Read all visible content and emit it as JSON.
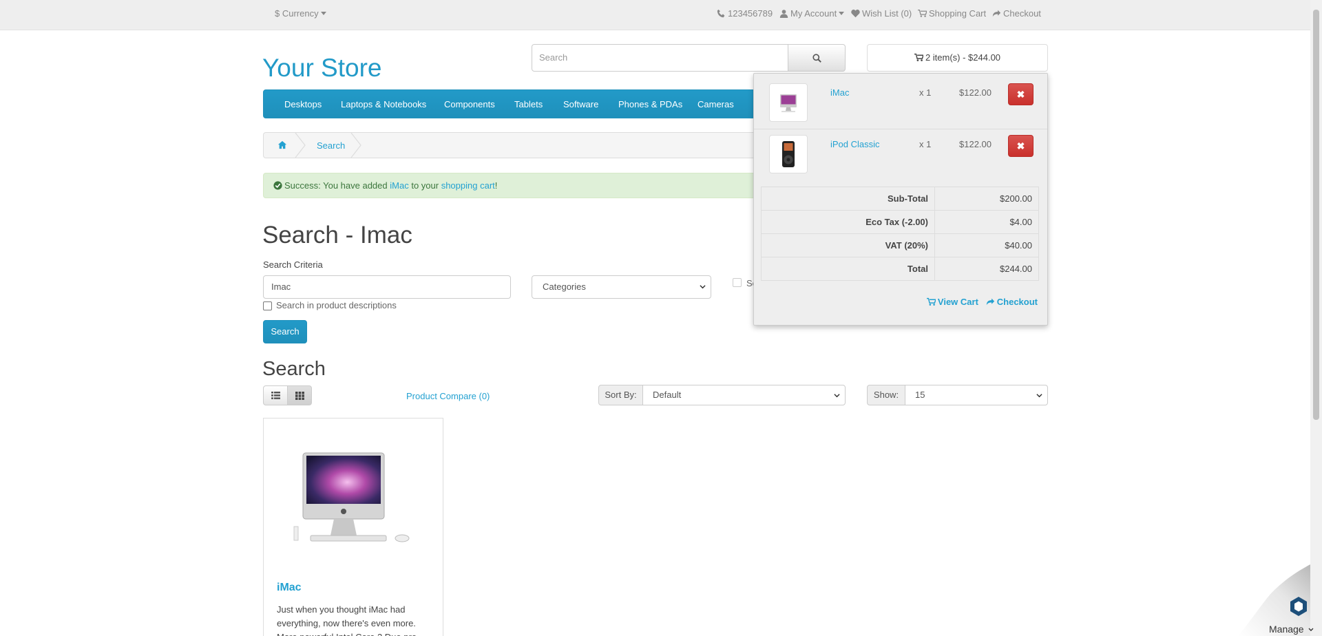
{
  "topbar": {
    "currency": "$ Currency",
    "phone": "123456789",
    "my_account": "My Account",
    "wishlist": "Wish List (0)",
    "shopping_cart": "Shopping Cart",
    "checkout": "Checkout"
  },
  "header": {
    "logo": "Your Store",
    "search_placeholder": "Search",
    "cart_button": "2 item(s) - $244.00"
  },
  "menu": [
    "Desktops",
    "Laptops & Notebooks",
    "Components",
    "Tablets",
    "Software",
    "Phones & PDAs",
    "Cameras"
  ],
  "breadcrumb": {
    "current": "Search"
  },
  "alert": {
    "prefix": "Success: You have added",
    "product": "iMac",
    "middle": "to your",
    "link": "shopping cart",
    "suffix": "!"
  },
  "page": {
    "title": "Search - Imac",
    "criteria_label": "Search Criteria",
    "criteria_value": "Imac",
    "category_select": "Categories",
    "search_desc_label": "Search in product descriptions",
    "subcategory_label": "Se",
    "search_button": "Search",
    "results_title": "Search",
    "compare_link": "Product Compare (0)",
    "sort_label": "Sort By:",
    "sort_value": "Default",
    "show_label": "Show:",
    "show_value": "15"
  },
  "product": {
    "name": "iMac",
    "description_lines": [
      "Just when you thought iMac had",
      "everything, now there's even more.",
      "More powerful Intel Core 2 Duo pro"
    ]
  },
  "cart": {
    "items": [
      {
        "name": "iMac",
        "qty": "x 1",
        "price": "$122.00"
      },
      {
        "name": "iPod Classic",
        "qty": "x 1",
        "price": "$122.00"
      }
    ],
    "totals": [
      {
        "label": "Sub-Total",
        "value": "$200.00"
      },
      {
        "label": "Eco Tax (-2.00)",
        "value": "$4.00"
      },
      {
        "label": "VAT (20%)",
        "value": "$40.00"
      },
      {
        "label": "Total",
        "value": "$244.00"
      }
    ],
    "view_cart": "View Cart",
    "checkout": "Checkout",
    "remove_glyph": "✖"
  },
  "manage": {
    "label": "Manage"
  },
  "colors": {
    "brand": "#229ac8",
    "link": "#23a1d1",
    "danger": "#d9534f",
    "success_bg": "#dff0d8"
  }
}
